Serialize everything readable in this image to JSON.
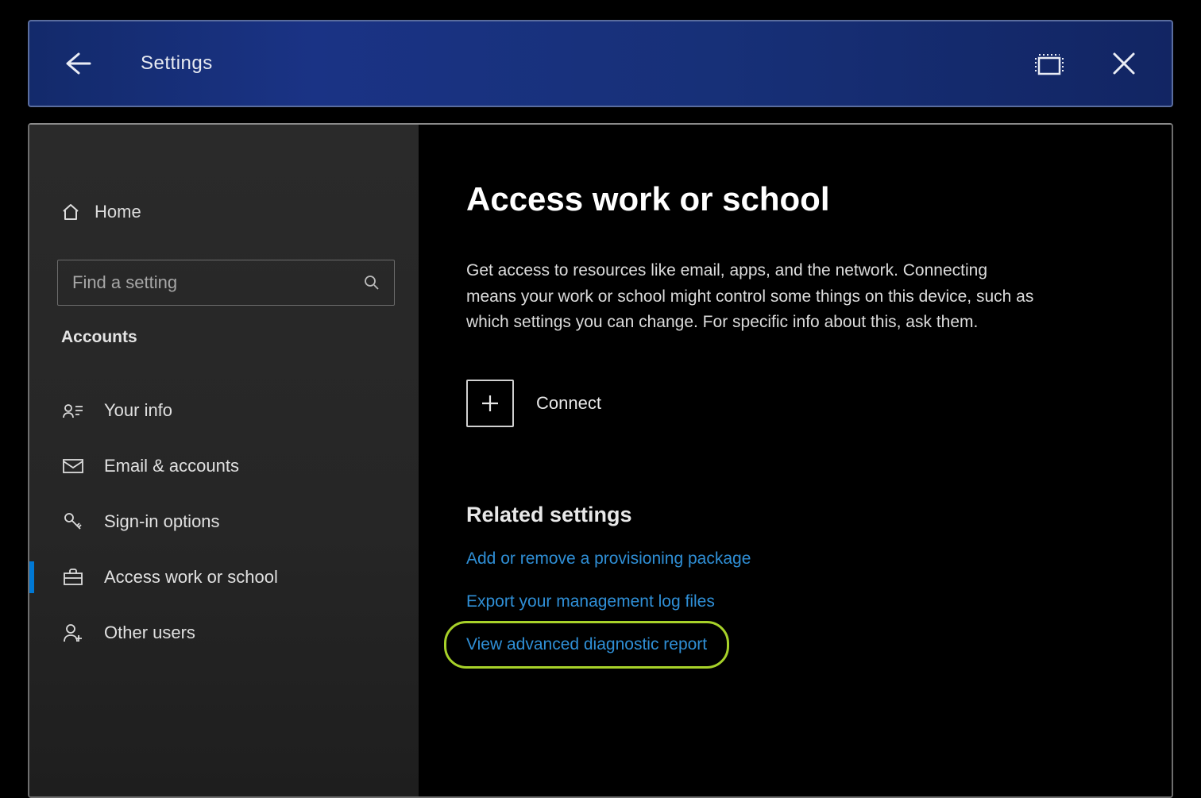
{
  "titlebar": {
    "title": "Settings"
  },
  "sidebar": {
    "home_label": "Home",
    "search_placeholder": "Find a setting",
    "category_label": "Accounts",
    "items": [
      {
        "label": "Your info"
      },
      {
        "label": "Email & accounts"
      },
      {
        "label": "Sign-in options"
      },
      {
        "label": "Access work or school"
      },
      {
        "label": "Other users"
      }
    ]
  },
  "main": {
    "page_title": "Access work or school",
    "description": "Get access to resources like email, apps, and the network. Connecting means your work or school might control some things on this device, such as which settings you can change. For specific info about this, ask them.",
    "connect_label": "Connect",
    "related_title": "Related settings",
    "links": [
      {
        "label": "Add or remove a provisioning package"
      },
      {
        "label": "Export your management log files"
      },
      {
        "label": "View advanced diagnostic report"
      }
    ]
  },
  "highlight": {
    "target_link_index": 2
  }
}
